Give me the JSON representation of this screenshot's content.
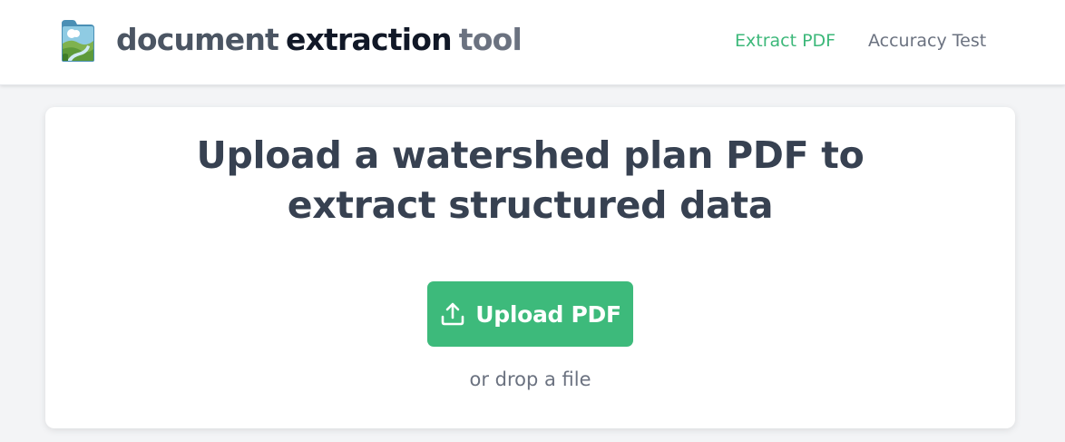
{
  "header": {
    "logo_icon": "watershed-landscape-icon",
    "brand": {
      "word1": "document",
      "word2": "extraction",
      "word3": "tool"
    },
    "nav": [
      {
        "label": "Extract PDF",
        "active": true
      },
      {
        "label": "Accuracy Test",
        "active": false
      }
    ]
  },
  "main": {
    "headline_line1": "Upload a watershed plan PDF to",
    "headline_line2": "extract structured data",
    "upload_button": {
      "label": "Upload PDF",
      "icon": "upload-icon"
    },
    "drop_hint": "or drop a file"
  },
  "colors": {
    "accent": "#3dba7b",
    "nav_active": "#3db87a",
    "heading": "#374151",
    "muted": "#6b7280",
    "background": "#f3f4f6"
  }
}
